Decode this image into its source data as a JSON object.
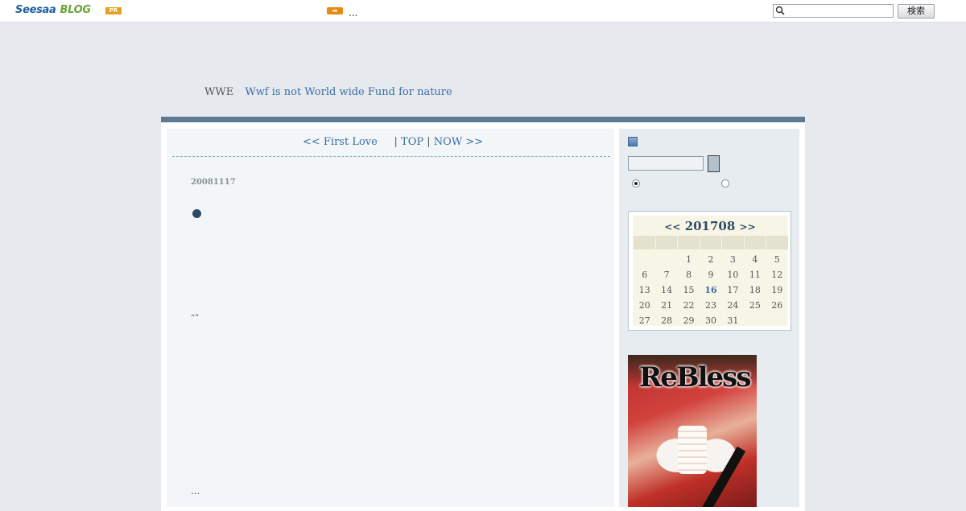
{
  "topbar": {
    "logo_brand": "Seesaa",
    "logo_product": "BLOG",
    "pr_badge": "PR",
    "arrow_badge": "➡",
    "ellipsis": "...",
    "search_placeholder": "",
    "search_button": "検索"
  },
  "header": {
    "blog_title": "WWE",
    "blog_description": "Wwf is not World wide Fund for nature"
  },
  "post_nav": {
    "prev": "<< First Love",
    "top": "TOP",
    "next": "NOW >>",
    "separator": "|"
  },
  "post": {
    "date": "20081117",
    "quote_marks": "“”",
    "ellipsis": "..."
  },
  "calendar": {
    "prev": "<<",
    "month": "201708",
    "next": ">>",
    "weekdays": [
      "",
      "",
      "",
      "",
      "",
      "",
      ""
    ],
    "days": [
      "",
      "",
      "1",
      "2",
      "3",
      "4",
      "5",
      "6",
      "7",
      "8",
      "9",
      "10",
      "11",
      "12",
      "13",
      "14",
      "15",
      "16",
      "17",
      "18",
      "19",
      "20",
      "21",
      "22",
      "23",
      "24",
      "25",
      "26",
      "27",
      "28",
      "29",
      "30",
      "31",
      "",
      ""
    ],
    "today": "16"
  },
  "ad": {
    "title": "ReBless"
  },
  "colors": {
    "accent": "#5d7a94",
    "link": "#3a6ea5",
    "background": "#e6e9ee"
  }
}
